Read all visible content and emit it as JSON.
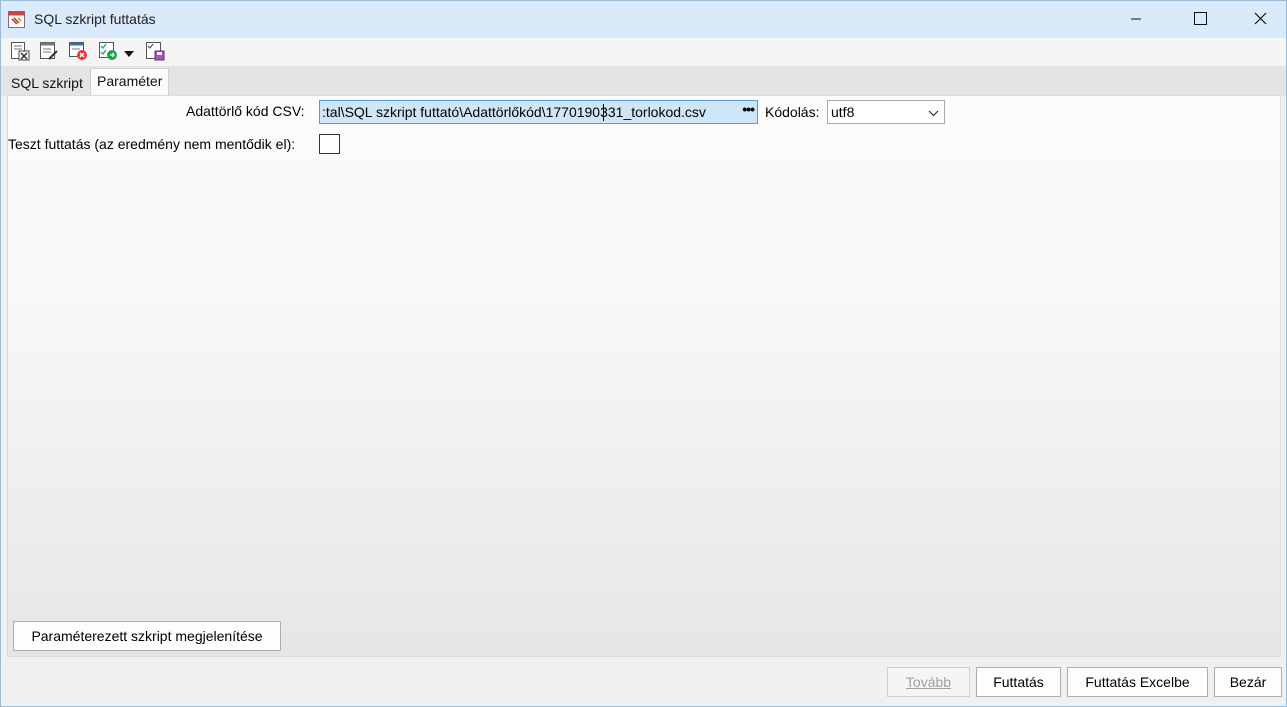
{
  "window": {
    "title": "SQL szkript futtatás",
    "controls": {
      "minimize": "minimize-icon",
      "maximize": "maximize-icon",
      "close": "close-icon"
    }
  },
  "toolbar": {
    "icons": [
      "excel-export-icon",
      "edit-list-icon",
      "delete-table-icon",
      "checklist-run-icon",
      "dropdown-arrow-icon",
      "save-list-icon"
    ]
  },
  "tabs": [
    {
      "label": "SQL szkript",
      "active": false
    },
    {
      "label": "Paraméter",
      "active": true
    }
  ],
  "form": {
    "csv_label": "Adattörlő kód CSV:",
    "csv_value": ":tal\\SQL szkript futtató\\Adattörlőkód\\1770190331_torlokod.csv",
    "csv_browse": "•••",
    "encoding_label": "Kódolás:",
    "encoding_value": "utf8",
    "test_label": "Teszt futtatás (az eredmény nem mentődik el):",
    "test_checked": false
  },
  "buttons": {
    "show_script": "Paraméterezett szkript megjelenítése",
    "next": "Tovább",
    "run": "Futtatás",
    "run_excel": "Futtatás Excelbe",
    "close": "Bezár"
  },
  "colors": {
    "titlebar": "#d9eafa",
    "input_highlight": "#cfe6f8",
    "input_border": "#5a9bd5"
  }
}
